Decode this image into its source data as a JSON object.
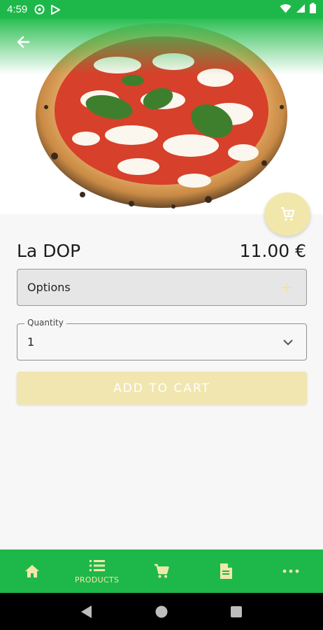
{
  "status_bar": {
    "time": "4:59",
    "icons": [
      "at-sign-icon",
      "play-icon",
      "wifi-icon",
      "signal-icon",
      "battery-icon"
    ]
  },
  "header": {
    "back_icon": "arrow-left-icon"
  },
  "product": {
    "name": "La DOP",
    "price": "11.00 €"
  },
  "options": {
    "label": "Options",
    "icon": "plus-icon"
  },
  "quantity": {
    "legend": "Quantity",
    "value": "1"
  },
  "add_to_cart": {
    "label": "ADD TO CART"
  },
  "bottom_nav": {
    "items": [
      {
        "icon": "home-icon",
        "label": ""
      },
      {
        "icon": "list-icon",
        "label": "PRODUCTS"
      },
      {
        "icon": "cart-icon",
        "label": ""
      },
      {
        "icon": "document-icon",
        "label": ""
      },
      {
        "icon": "more-icon",
        "label": ""
      }
    ]
  },
  "colors": {
    "primary_green": "#1eb84a",
    "accent_yellow": "#f2e7aa",
    "background": "#f7f7f7"
  }
}
